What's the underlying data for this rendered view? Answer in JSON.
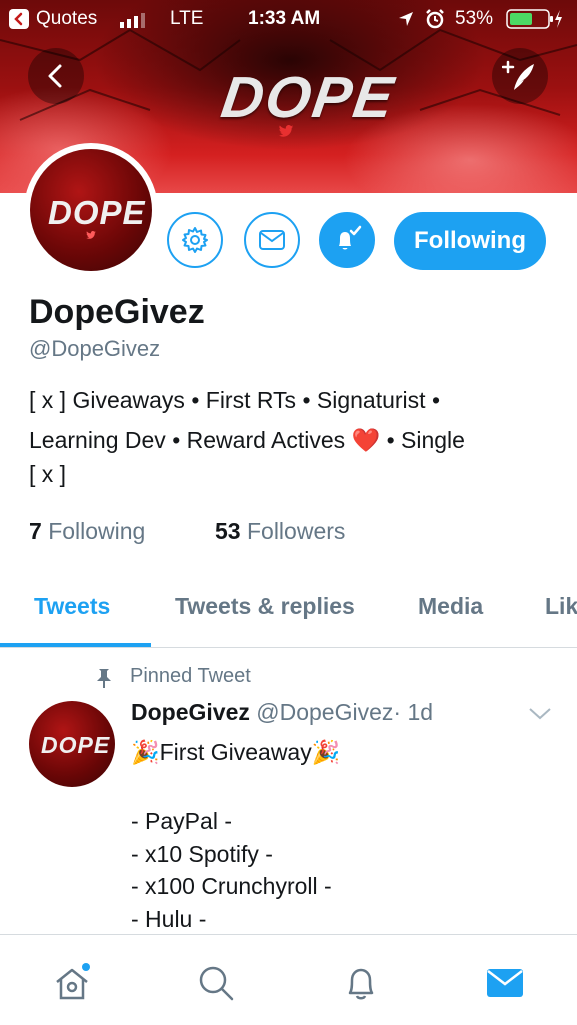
{
  "status_bar": {
    "back_app": "Quotes",
    "network": "LTE",
    "time": "1:33 AM",
    "battery": "53%"
  },
  "banner": {
    "logo_text": "DOPE"
  },
  "avatar": {
    "logo_text": "DOPE"
  },
  "profile": {
    "display_name": "DopeGivez",
    "handle": "@DopeGivez",
    "bio_line1": "[ x ] Giveaways • First RTs • Signaturist •",
    "bio_line2": "Learning Dev • Reward Actives ❤️ • Single",
    "bio_line3": "[ x ]",
    "following_count": "7",
    "following_label": "Following",
    "followers_count": "53",
    "followers_label": "Followers"
  },
  "actions": {
    "follow_state_label": "Following"
  },
  "tabs": [
    {
      "label": "Tweets",
      "active": true
    },
    {
      "label": "Tweets & replies",
      "active": false
    },
    {
      "label": "Media",
      "active": false
    },
    {
      "label": "Lik",
      "active": false
    }
  ],
  "pinned_tweet": {
    "pinned_label": "Pinned Tweet",
    "author_name": "DopeGivez",
    "author_handle": "@DopeGivez",
    "time": "· 1d",
    "avatar_text": "DOPE",
    "text_line1": "🎉First Giveaway🎉",
    "items": [
      "- PayPal -",
      "- x10 Spotify -",
      "- x100 Crunchyroll -",
      "- Hulu -"
    ]
  },
  "bottom_nav": [
    "home-icon",
    "search-icon",
    "notifications-icon",
    "messages-icon"
  ],
  "colors": {
    "accent": "#1da1f2",
    "banner_red": "#c41a1a",
    "secondary_text": "#657786"
  }
}
